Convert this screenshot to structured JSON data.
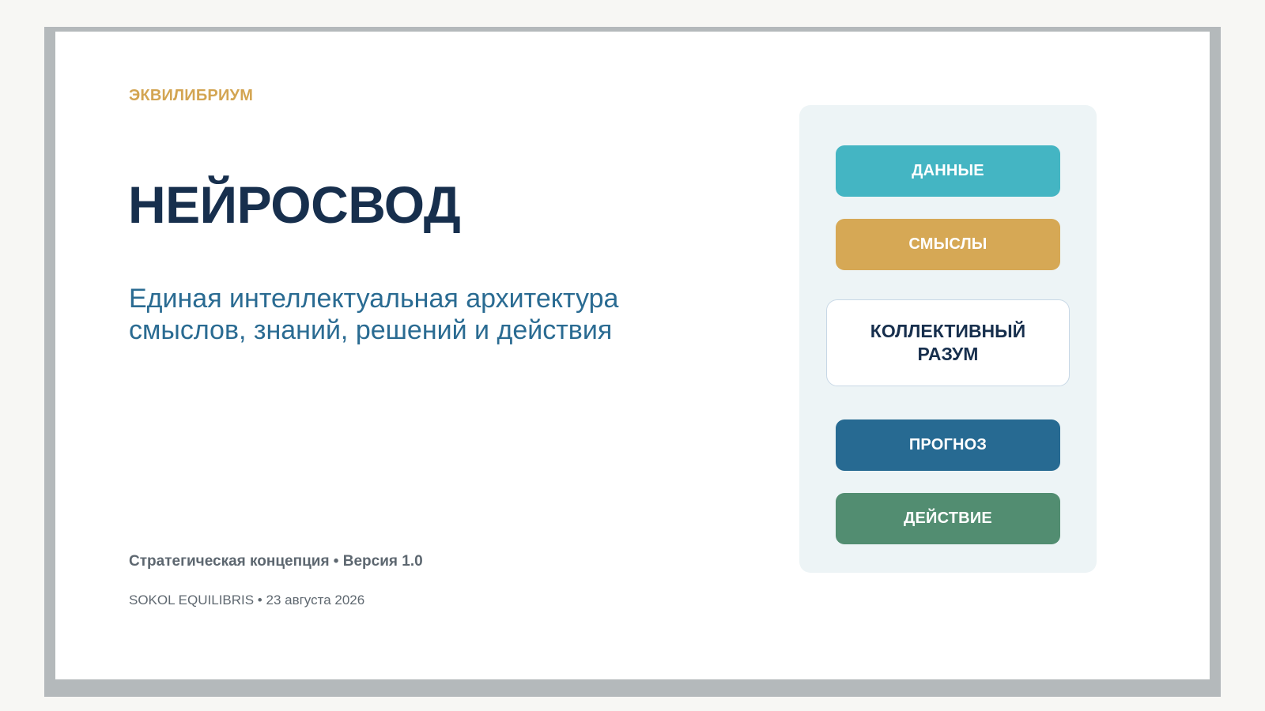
{
  "slide": {
    "brand": "ЭКВИЛИБРИУМ",
    "title": "НЕЙРОСВОД",
    "subtitle_lines": [
      "Единая интеллектуальная архитектура",
      "смыслов, знаний, решений и действия"
    ],
    "meta": "Стратегическая концепция • Версия 1.0",
    "footer": "SOKOL EQUILIBRIS • 23 августа 2026"
  },
  "panel": {
    "items": [
      {
        "label": "ДАННЫЕ",
        "color": "#44b5c3"
      },
      {
        "label": "СМЫСЛЫ",
        "color": "#d6a855"
      },
      {
        "label": "ПРОГНОЗ",
        "color": "#276a92"
      },
      {
        "label": "ДЕЙСТВИЕ",
        "color": "#528d71"
      }
    ],
    "core": {
      "lines": [
        "КОЛЛЕКТИВНЫЙ",
        "РАЗУМ"
      ]
    }
  },
  "colors": {
    "title": "#172f4d",
    "accent_gold": "#d3a552",
    "subtitle_blue": "#2a6b92",
    "panel_bg": "#edf4f6",
    "frame": "#b4b9bb"
  }
}
